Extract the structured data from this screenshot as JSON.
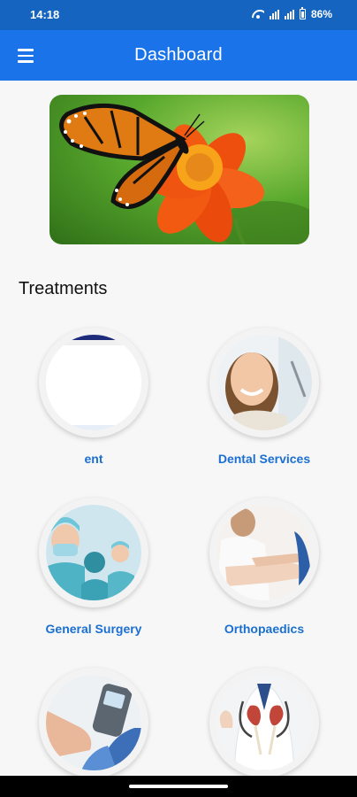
{
  "status_bar": {
    "time": "14:18",
    "battery": "86%"
  },
  "app_bar": {
    "title": "Dashboard",
    "menu_icon": "hamburger-menu-icon"
  },
  "banner": {
    "image": "butterfly-on-orange-flower"
  },
  "treatments": {
    "heading": "Treatments",
    "items": [
      {
        "label": "ent",
        "image": "ent-placeholder"
      },
      {
        "label": "Dental Services",
        "image": "smiling-dental-patient"
      },
      {
        "label": "General Surgery",
        "image": "surgical-team"
      },
      {
        "label": "Orthopaedics",
        "image": "arm-examination"
      },
      {
        "label": "",
        "image": "glucose-meter"
      },
      {
        "label": "",
        "image": "doctor-with-kidney-model"
      }
    ]
  },
  "colors": {
    "primary": "#1a73e8",
    "status_bar": "#1565c0",
    "label": "#1a6fd0",
    "background": "#f7f7f7"
  }
}
